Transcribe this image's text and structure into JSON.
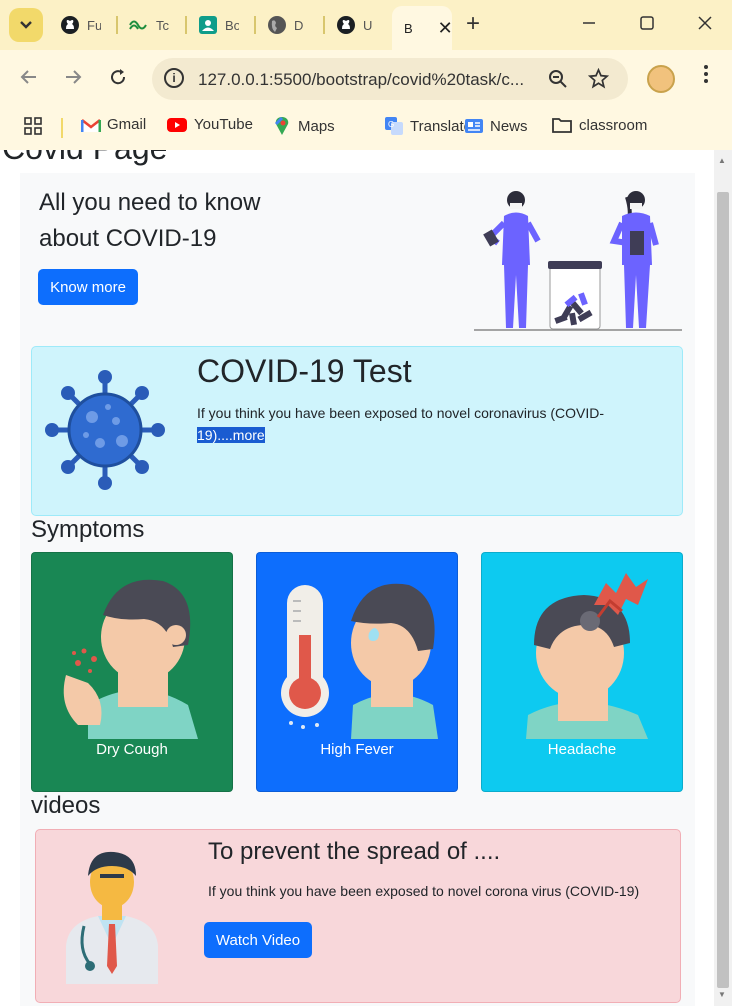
{
  "browser": {
    "tabs": [
      {
        "title": "Fu",
        "icon": "github-icon"
      },
      {
        "title": "Tc",
        "icon": "gitlens-icon"
      },
      {
        "title": "Bo",
        "icon": "contact-icon"
      },
      {
        "title": "D",
        "icon": "globe-icon"
      },
      {
        "title": "U",
        "icon": "github-icon"
      }
    ],
    "active_tab": {
      "title": "B"
    },
    "url": "127.0.0.1:5500/bootstrap/covid%20task/c...",
    "bookmarks": [
      {
        "label": "Gmail",
        "icon": "gmail-icon"
      },
      {
        "label": "YouTube",
        "icon": "youtube-icon"
      },
      {
        "label": "Maps",
        "icon": "maps-icon"
      },
      {
        "label": "Translate",
        "icon": "translate-icon"
      },
      {
        "label": "News",
        "icon": "news-icon"
      },
      {
        "label": "classroom",
        "icon": "folder-icon"
      }
    ],
    "colors": {
      "chrome_bg": "#fcf1c6",
      "toolbar_bg": "#fff8e1"
    }
  },
  "page": {
    "title_cut": "Covid Page",
    "hero": {
      "title": "All you need to know about COVID-19",
      "button": "Know more"
    },
    "test_card": {
      "title": "COVID-19 Test",
      "text": "If you think you have been exposed to novel coronavirus (COVID-",
      "link": "19)....more"
    },
    "symptoms": {
      "heading": "Symptoms",
      "items": [
        {
          "label": "Dry Cough",
          "color": "#198754"
        },
        {
          "label": "High Fever",
          "color": "#0d6efd"
        },
        {
          "label": "Headache",
          "color": "#0dcaf0"
        }
      ]
    },
    "videos": {
      "heading": "videos",
      "card_title": "To prevent the spread of ....",
      "card_text": "If you think you have been exposed to novel corona virus (COVID-19)",
      "button": "Watch Video"
    },
    "colors": {
      "primary": "#0d6efd",
      "info_bg": "#cff4fc",
      "danger_bg": "#f8d7da"
    }
  }
}
